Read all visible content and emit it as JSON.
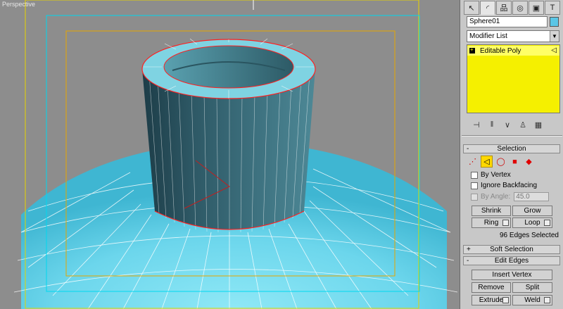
{
  "viewport": {
    "label": "Perspective"
  },
  "colors": {
    "mesh": "#5fd4ea",
    "wire": "#ffffff",
    "selected_edge": "#ff2020",
    "safe_frame_outer": "#00e0ff",
    "safe_frame_inner": "#e6b400"
  },
  "panel": {
    "tabs": [
      {
        "icon": "create-icon",
        "glyph": "↖"
      },
      {
        "icon": "modify-icon",
        "glyph": "◜"
      },
      {
        "icon": "hierarchy-icon",
        "glyph": "品"
      },
      {
        "icon": "motion-icon",
        "glyph": "◎"
      },
      {
        "icon": "display-icon",
        "glyph": "▣"
      },
      {
        "icon": "utilities-icon",
        "glyph": "T"
      }
    ],
    "object_name": "Sphere01",
    "object_color": "#5bc6e6",
    "modifier_list": "Modifier List",
    "stack_item": "Editable Poly",
    "selection": {
      "title": "Selection",
      "levels": [
        {
          "icon": "vertex-icon",
          "glyph": "⋰"
        },
        {
          "icon": "edge-icon",
          "glyph": "◁"
        },
        {
          "icon": "border-icon",
          "glyph": "◯"
        },
        {
          "icon": "polygon-icon",
          "glyph": "■"
        },
        {
          "icon": "element-icon",
          "glyph": "◆"
        }
      ],
      "by_vertex": "By Vertex",
      "ignore_backfacing": "Ignore Backfacing",
      "by_angle": "By Angle:",
      "angle_value": "45.0",
      "shrink": "Shrink",
      "grow": "Grow",
      "ring": "Ring",
      "loop": "Loop",
      "status": "96 Edges Selected"
    },
    "soft_selection": "Soft Selection",
    "edit_edges": {
      "title": "Edit Edges",
      "insert_vertex": "Insert Vertex",
      "remove": "Remove",
      "split": "Split",
      "extrude": "Extrude",
      "weld": "Weld"
    }
  }
}
